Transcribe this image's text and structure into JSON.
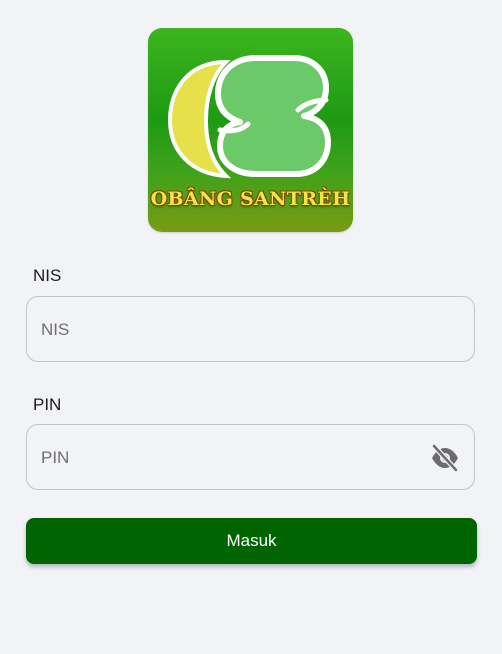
{
  "logo": {
    "text": "OBÂNG SANTRÈH",
    "letter_mark": "S"
  },
  "form": {
    "nis": {
      "label": "NIS",
      "placeholder": "NIS",
      "value": ""
    },
    "pin": {
      "label": "PIN",
      "placeholder": "PIN",
      "value": "",
      "toggle_icon": "eye-off-icon"
    },
    "submit_label": "Masuk"
  },
  "colors": {
    "background": "#f2f3f7",
    "button": "#006400",
    "logo_green": "#1e9a14",
    "logo_yellow": "#e6e04a"
  }
}
